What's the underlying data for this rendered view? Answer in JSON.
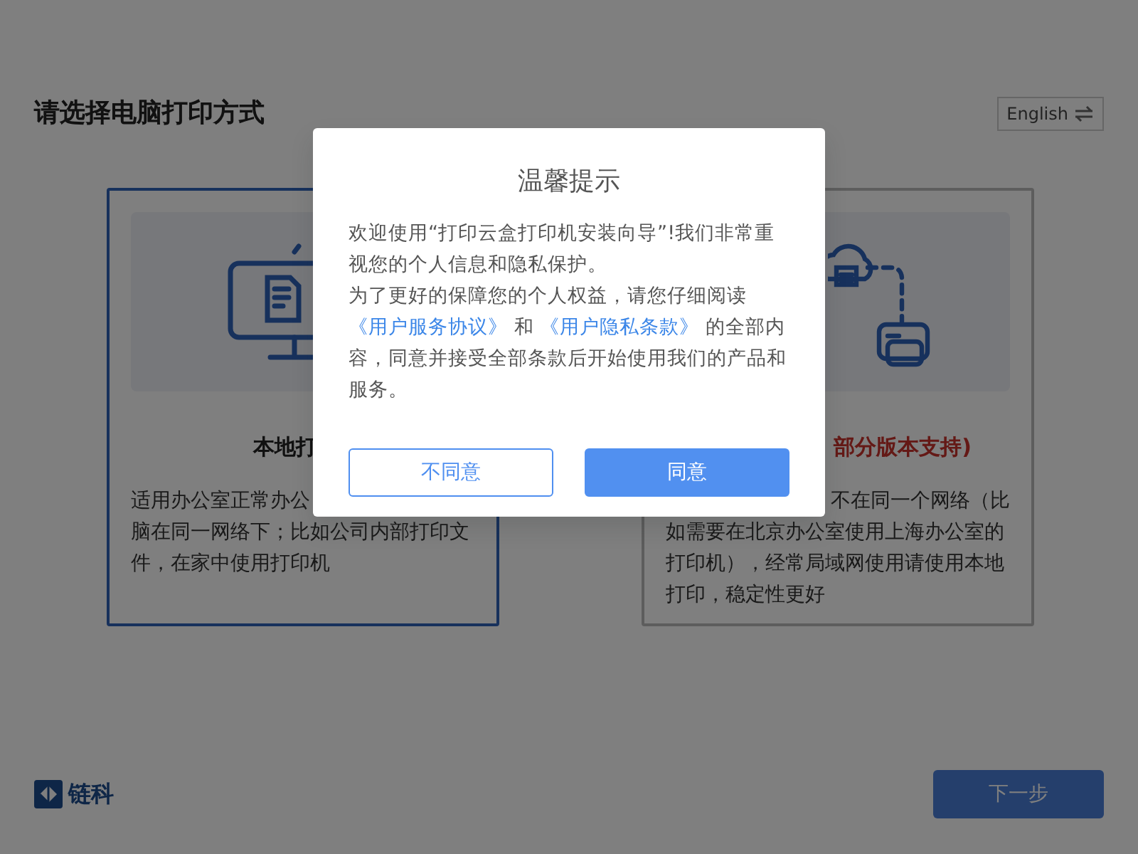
{
  "page": {
    "title": "请选择电脑打印方式",
    "language_button": "English"
  },
  "cards": [
    {
      "title": "本地打",
      "selected": true,
      "lines": [
        "适用办公室正常办公",
        "脑在同一网络下；比如公司内部打印文",
        "件，在家中使用打印机"
      ]
    },
    {
      "title": "部分版本支持)",
      "selected": false,
      "lines": [
        "不在同一个网络（比",
        "如需要在北京办公室使用上海办公室的",
        "打印机），经常局域网使用请使用本地",
        "打印，稳定性更好"
      ]
    }
  ],
  "footer": {
    "logo_text": "链科",
    "next_button": "下一步"
  },
  "dialog": {
    "title": "温馨提示",
    "paragraphs": [
      {
        "parts": [
          {
            "kind": "text",
            "text": "欢迎使用“打印云盒打印机安装向导”!我们非常重视您的个人信息和隐私保护。"
          }
        ]
      },
      {
        "parts": [
          {
            "kind": "text",
            "text": "为了更好的保障您的个人权益，请您仔细阅读"
          },
          {
            "kind": "link",
            "text": "《用户服务协议》"
          },
          {
            "kind": "text",
            "text": " 和 "
          },
          {
            "kind": "link",
            "text": "《用户隐私条款》"
          },
          {
            "kind": "text",
            "text": " 的全部内容，同意并接受全部条款后开始使用我们的产品和服务。"
          }
        ]
      }
    ],
    "buttons": [
      {
        "label": "不同意",
        "kind": "outline"
      },
      {
        "label": "同意",
        "kind": "primary"
      }
    ]
  }
}
